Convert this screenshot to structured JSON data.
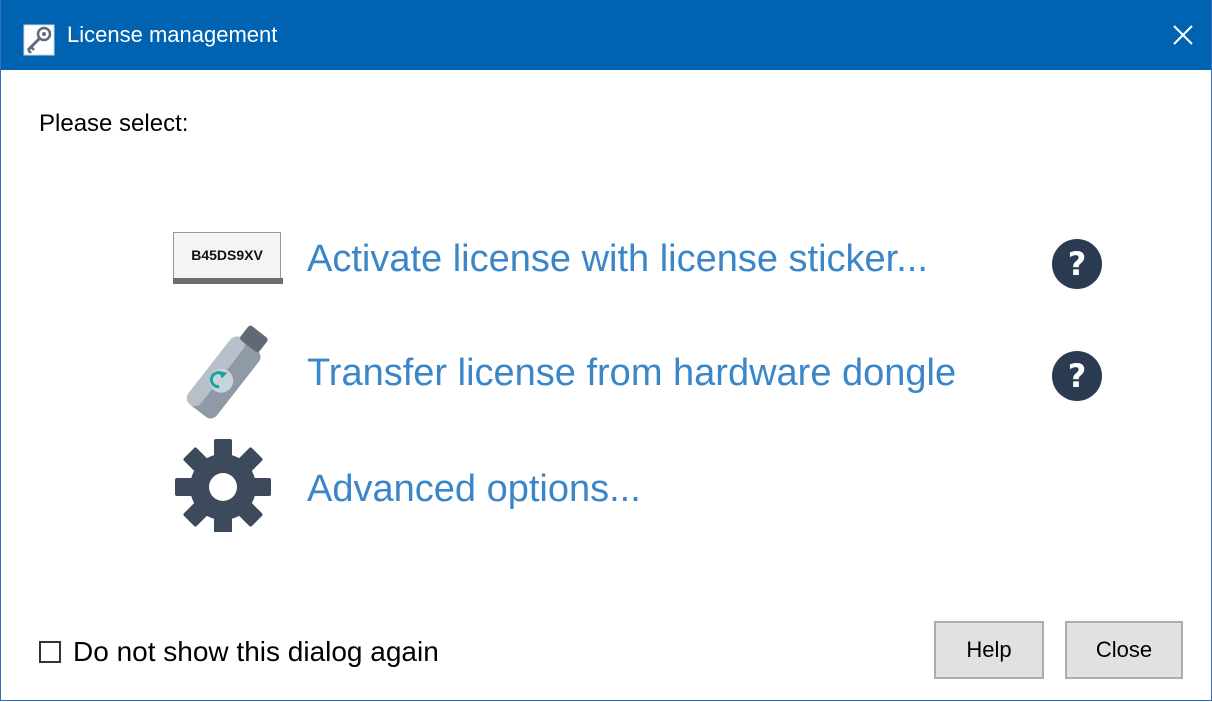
{
  "window": {
    "title": "License management"
  },
  "prompt": "Please select:",
  "options": [
    {
      "label": "Activate license with license sticker...",
      "icon": "license-sticker-icon",
      "sticker_code": "B45DS9XV",
      "has_help": true
    },
    {
      "label": "Transfer license from hardware dongle",
      "icon": "usb-dongle-icon",
      "has_help": true
    },
    {
      "label": "Advanced options...",
      "icon": "gear-icon",
      "has_help": false
    }
  ],
  "help_glyph": "?",
  "footer": {
    "checkbox_label": "Do not show this dialog again",
    "checkbox_checked": false,
    "help_button": "Help",
    "close_button": "Close"
  },
  "colors": {
    "titlebar": "#0063b1",
    "link": "#3a86c8",
    "help_circle": "#2b3c52",
    "button_bg": "#e1e1e1",
    "gear": "#3d4a5c"
  }
}
